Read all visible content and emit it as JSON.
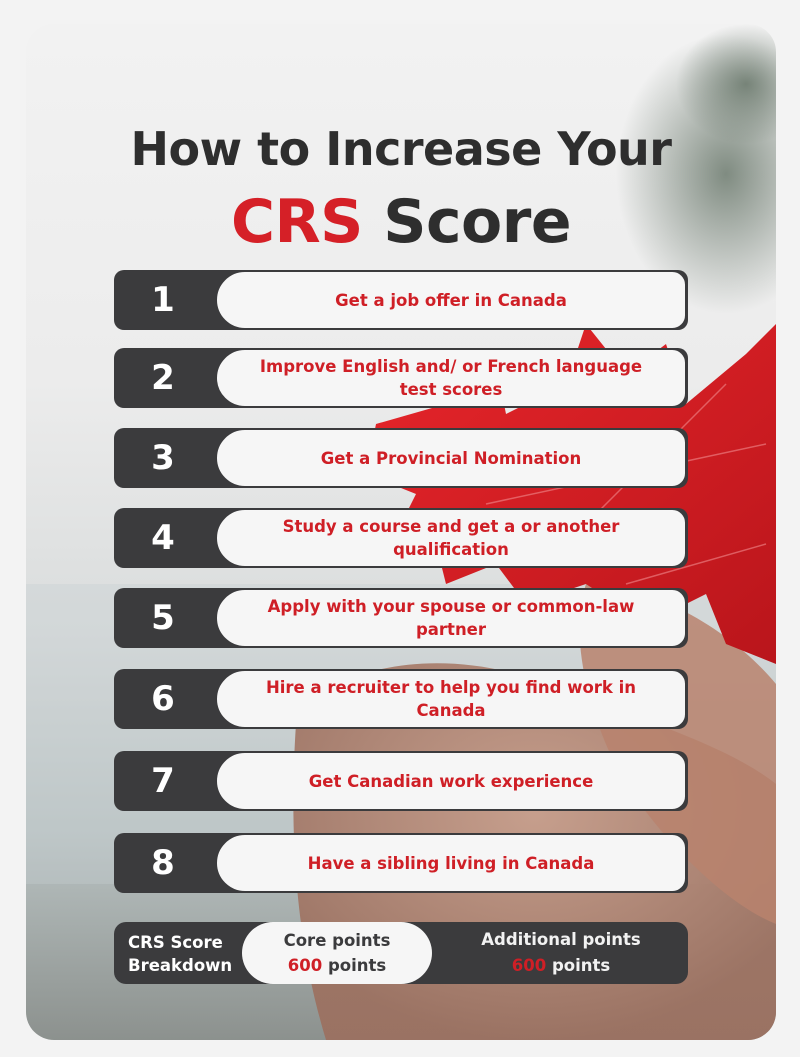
{
  "title": {
    "line1": "How to Increase Your",
    "line2_accent": "CRS",
    "line2_rest": " Score"
  },
  "colors": {
    "accent": "#d52027",
    "dark": "#3b3b3d",
    "pill": "#f6f6f6"
  },
  "steps": [
    {
      "number": "1",
      "text": "Get a job offer in Canada"
    },
    {
      "number": "2",
      "text": "Improve English and/ or French language test scores"
    },
    {
      "number": "3",
      "text": "Get a Provincial Nomination"
    },
    {
      "number": "4",
      "text": "Study a course and get a or another qualification"
    },
    {
      "number": "5",
      "text": "Apply with your spouse or common-law partner"
    },
    {
      "number": "6",
      "text": "Hire a recruiter to help you find work in Canada"
    },
    {
      "number": "7",
      "text": "Get Canadian work experience"
    },
    {
      "number": "8",
      "text": "Have a sibling living in Canada"
    }
  ],
  "breakdown": {
    "label_line1": "CRS Score",
    "label_line2": "Breakdown",
    "core_label": "Core points",
    "core_value": "600",
    "core_unit": " points",
    "additional_label": "Additional points",
    "additional_value": "600",
    "additional_unit": " points"
  },
  "background": {
    "photo_subject": "red-maple-leaf-held-in-hands"
  }
}
